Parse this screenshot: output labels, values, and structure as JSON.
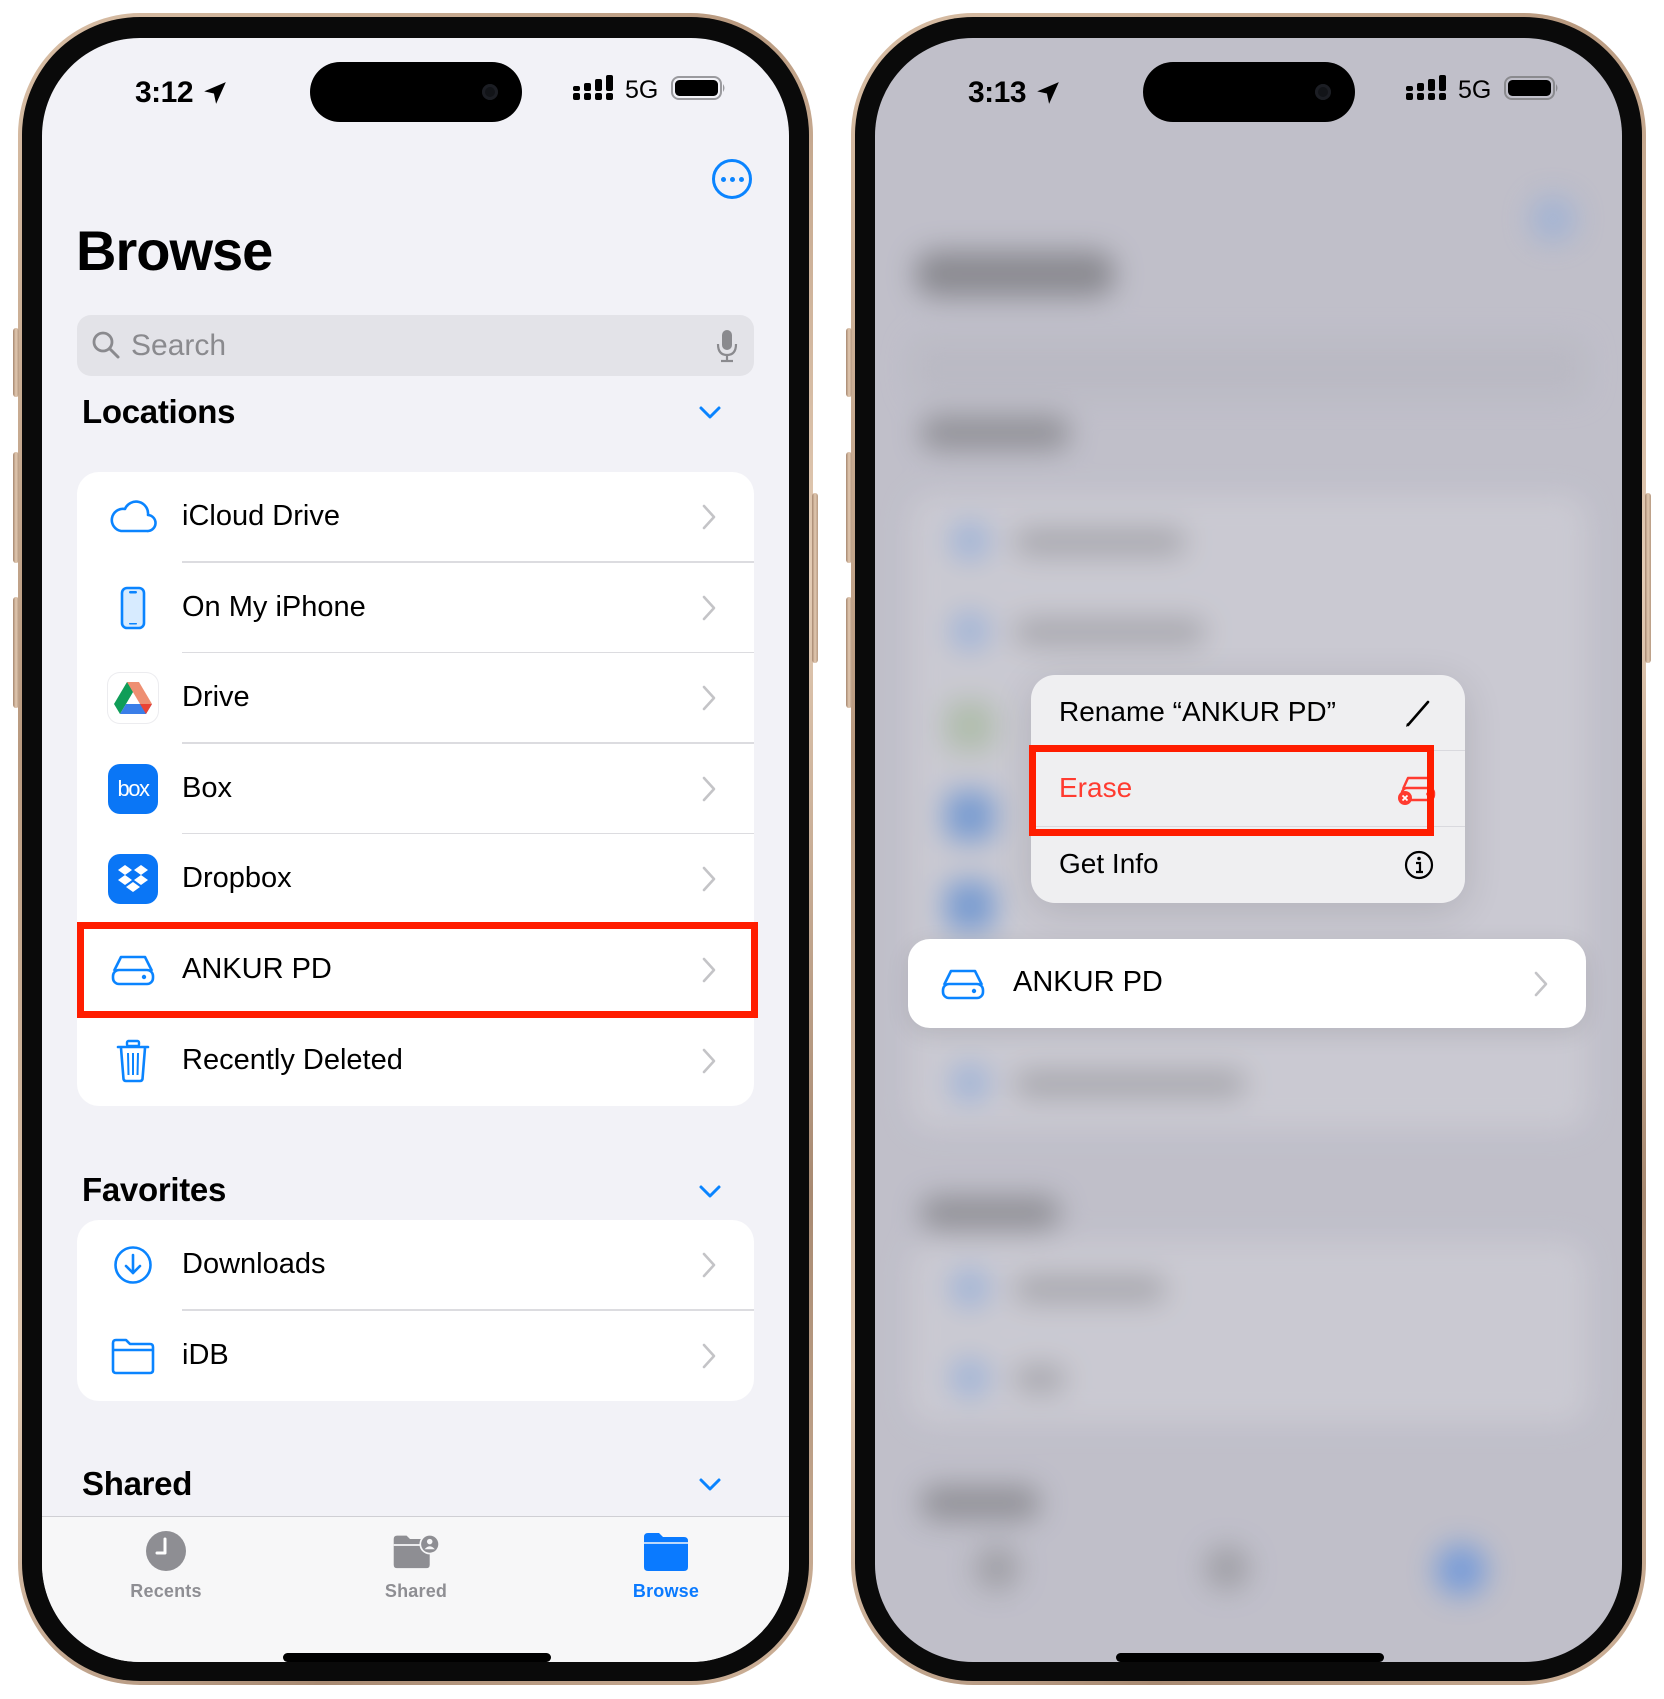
{
  "colors": {
    "accent": "#0a84ff",
    "highlight": "#ff1d00",
    "destructive": "#ff3b30",
    "chevron": "#c4c4c7",
    "tab_inactive": "#8e8e93"
  },
  "left_phone": {
    "status_bar": {
      "time": "3:12",
      "network": "5G",
      "location_icon": "location-arrow-icon",
      "signal_icon": "cellular-signal-icon",
      "battery_icon": "battery-full-icon"
    },
    "more_button_icon": "ellipsis-circle-icon",
    "title": "Browse",
    "search": {
      "placeholder": "Search",
      "icon": "magnifying-glass-icon",
      "mic_icon": "microphone-icon"
    },
    "sections": {
      "locations": {
        "title": "Locations",
        "items": [
          {
            "label": "iCloud Drive",
            "icon": "icloud-icon"
          },
          {
            "label": "On My iPhone",
            "icon": "iphone-icon"
          },
          {
            "label": "Drive",
            "icon": "google-drive-icon"
          },
          {
            "label": "Box",
            "icon": "box-app-icon",
            "icon_text": "box"
          },
          {
            "label": "Dropbox",
            "icon": "dropbox-icon"
          },
          {
            "label": "ANKUR PD",
            "icon": "external-drive-icon",
            "highlighted": true
          },
          {
            "label": "Recently Deleted",
            "icon": "trash-icon"
          }
        ]
      },
      "favorites": {
        "title": "Favorites",
        "items": [
          {
            "label": "Downloads",
            "icon": "download-circle-icon"
          },
          {
            "label": "iDB",
            "icon": "folder-icon"
          }
        ]
      },
      "shared": {
        "title": "Shared"
      }
    },
    "tab_bar": [
      {
        "label": "Recents",
        "icon": "clock-icon",
        "active": false
      },
      {
        "label": "Shared",
        "icon": "shared-folder-icon",
        "active": false
      },
      {
        "label": "Browse",
        "icon": "folder-fill-icon",
        "active": true
      }
    ]
  },
  "right_phone": {
    "status_bar": {
      "time": "3:13",
      "network": "5G"
    },
    "context_menu": {
      "items": [
        {
          "label": "Rename “ANKUR PD”",
          "icon": "pencil-icon",
          "destructive": false
        },
        {
          "label": "Erase",
          "icon": "erase-drive-icon",
          "destructive": true,
          "highlighted": true
        },
        {
          "label": "Get Info",
          "icon": "info-circle-icon",
          "destructive": false
        }
      ]
    },
    "preview_item": {
      "label": "ANKUR PD",
      "icon": "external-drive-icon"
    }
  }
}
